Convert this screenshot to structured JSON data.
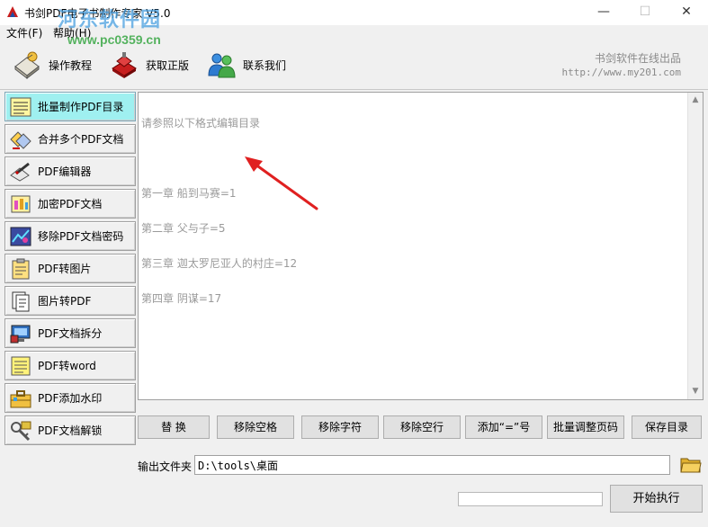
{
  "window": {
    "title": "书剑PDF电子书制作专家 V5.0",
    "minimize_glyph": "—",
    "maximize_glyph": "☐",
    "close_glyph": "✕"
  },
  "watermark": {
    "text": "河东软件园",
    "url": "www.pc0359.cn"
  },
  "menu": {
    "items": [
      {
        "label": "文件(F)"
      },
      {
        "label": "帮助(H)"
      }
    ]
  },
  "toolbar": {
    "tutorial_label": "操作教程",
    "buy_label": "获取正版",
    "contact_label": "联系我们",
    "brand_text": "书剑软件在线出品",
    "brand_url": "http://www.my201.com"
  },
  "sidebar": {
    "items": [
      {
        "label": "批量制作PDF目录"
      },
      {
        "label": "合并多个PDF文档"
      },
      {
        "label": "PDF编辑器"
      },
      {
        "label": "加密PDF文档"
      },
      {
        "label": "移除PDF文档密码"
      },
      {
        "label": "PDF转图片"
      },
      {
        "label": "图片转PDF"
      },
      {
        "label": "PDF文档拆分"
      },
      {
        "label": "PDF转word"
      },
      {
        "label": "PDF添加水印"
      },
      {
        "label": "PDF文档解锁"
      }
    ]
  },
  "editor": {
    "hint": "请参照以下格式编辑目录",
    "lines": [
      "第一章 船到马赛=1",
      "第二章 父与子=5",
      "第三章 迦太罗尼亚人的村庄=12",
      "第四章 阴谋=17"
    ]
  },
  "actions": {
    "replace": "替  换",
    "remove_spaces": "移除空格",
    "remove_chars": "移除字符",
    "remove_empty_lines": "移除空行",
    "add_equals": "添加“=”号",
    "batch_adjust_pages": "批量调整页码",
    "save_toc": "保存目录"
  },
  "output": {
    "label": "输出文件夹",
    "path": "D:\\tools\\桌面"
  },
  "progress": {
    "value": 0
  },
  "start_label": "开始执行",
  "colors": {
    "active_item": "#9ff0f0",
    "hint_text": "#9a9a9a",
    "arrow": "#e02020"
  }
}
